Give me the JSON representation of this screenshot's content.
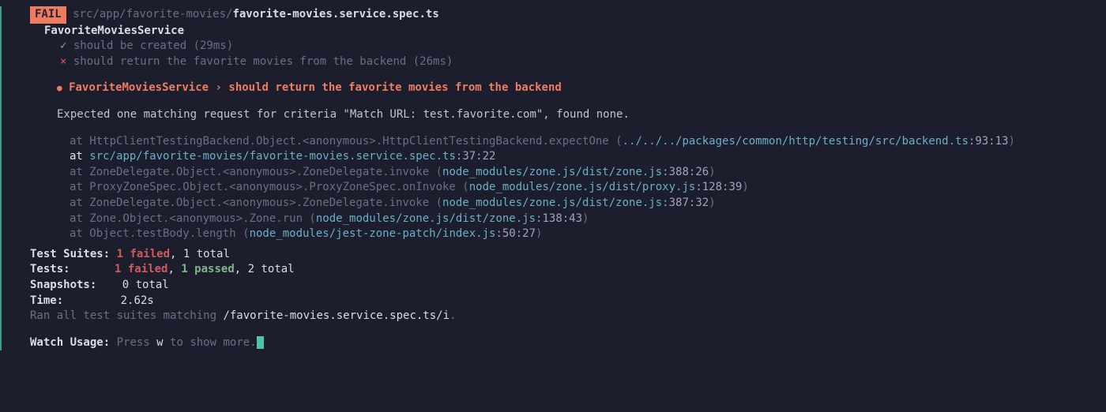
{
  "fail_badge": "FAIL",
  "file_path_dim": "src/app/favorite-movies/",
  "file_name": "favorite-movies.service.spec.ts",
  "describe": "FavoriteMoviesService",
  "tests": [
    {
      "status": "pass",
      "name": "should be created (29ms)"
    },
    {
      "status": "fail",
      "name": "should return the favorite movies from the backend (26ms)"
    }
  ],
  "check_glyph": "✓",
  "cross_glyph": "×",
  "bullet_glyph": "●",
  "failing_group": "FavoriteMoviesService",
  "chev": "›",
  "failing_test": "should return the favorite movies from the backend",
  "expected_msg": "Expected one matching request for criteria \"Match URL: test.favorite.com\", found none.",
  "stack": [
    {
      "pre": "at HttpClientTestingBackend.Object.<anonymous>.HttpClientTestingBackend.expectOne (",
      "path": "../../../packages/common/http/testing/src/backend.ts",
      "loc": ":93:13",
      "post": ")",
      "hl": false
    },
    {
      "pre": "at ",
      "path": "src/app/favorite-movies/favorite-movies.service.spec.ts",
      "loc": ":37:22",
      "post": "",
      "hl": true
    },
    {
      "pre": "at ZoneDelegate.Object.<anonymous>.ZoneDelegate.invoke (",
      "path": "node_modules/zone.js/dist/zone.js",
      "loc": ":388:26",
      "post": ")",
      "hl": false
    },
    {
      "pre": "at ProxyZoneSpec.Object.<anonymous>.ProxyZoneSpec.onInvoke (",
      "path": "node_modules/zone.js/dist/proxy.js",
      "loc": ":128:39",
      "post": ")",
      "hl": false
    },
    {
      "pre": "at ZoneDelegate.Object.<anonymous>.ZoneDelegate.invoke (",
      "path": "node_modules/zone.js/dist/zone.js",
      "loc": ":387:32",
      "post": ")",
      "hl": false
    },
    {
      "pre": "at Zone.Object.<anonymous>.Zone.run (",
      "path": "node_modules/zone.js/dist/zone.js",
      "loc": ":138:43",
      "post": ")",
      "hl": false
    },
    {
      "pre": "at Object.testBody.length (",
      "path": "node_modules/jest-zone-patch/index.js",
      "loc": ":50:27",
      "post": ")",
      "hl": false
    }
  ],
  "summary": {
    "suites_label": "Test Suites:",
    "suites_failed": "1 failed",
    "suites_rest": ", 1 total",
    "tests_label": "Tests:",
    "tests_failed": "1 failed",
    "tests_sep": ", ",
    "tests_passed": "1 passed",
    "tests_rest": ", 2 total",
    "snapshots_label": "Snapshots:",
    "snapshots_val": "0 total",
    "time_label": "Time:",
    "time_val": "2.62s",
    "ran_pre": "Ran all test suites matching ",
    "ran_pattern": "/favorite-movies.service.spec.ts/i",
    "ran_post": "."
  },
  "watch": {
    "label": "Watch Usage:",
    "rest_pre": " Press ",
    "rest_key": "w",
    "rest_post": " to show more."
  }
}
